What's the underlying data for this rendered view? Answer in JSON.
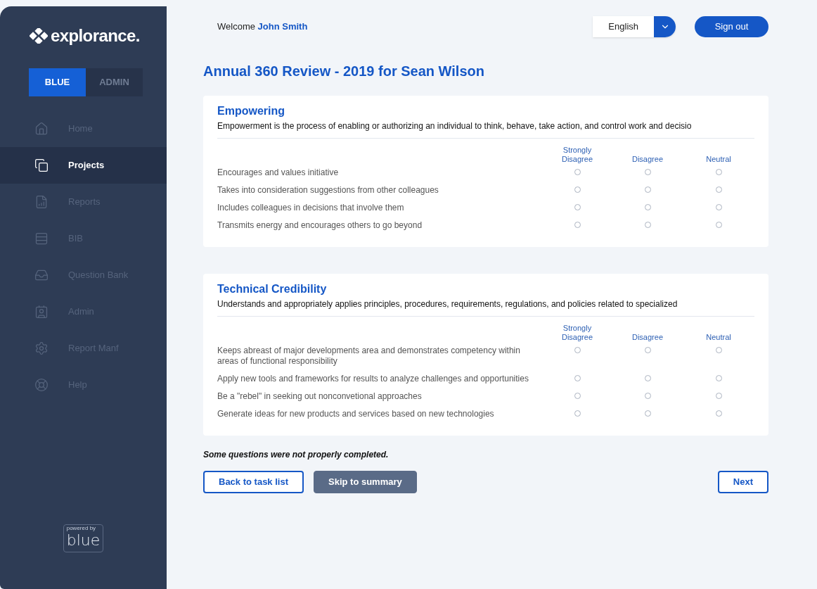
{
  "sidebar": {
    "logo": "explorance.",
    "modes": [
      {
        "label": "BLUE",
        "selected": true
      },
      {
        "label": "ADMIN",
        "selected": false
      }
    ],
    "items": [
      {
        "label": "Home",
        "selected": false
      },
      {
        "label": "Projects",
        "selected": true
      },
      {
        "label": "Reports",
        "selected": false
      },
      {
        "label": "BIB",
        "selected": false
      },
      {
        "label": "Question Bank",
        "selected": false
      },
      {
        "label": "Admin",
        "selected": false
      },
      {
        "label": "Report Manf",
        "selected": false
      },
      {
        "label": "Help",
        "selected": false
      }
    ],
    "badge": {
      "caption": "powered by",
      "name": "blue"
    }
  },
  "header": {
    "welcome": "Welcome",
    "user": "John Smith",
    "language": "English",
    "sign_out": "Sign out"
  },
  "title": "Annual 360 Review - 2019 for Sean Wilson",
  "sections": [
    {
      "title": "Empowering",
      "description": "Empowerment is the process of enabling or authorizing an individual to think, behave, take action, and control work and decisio",
      "columns": [
        "Strongly Disagree",
        "Disagree",
        "Neutral"
      ],
      "questions": [
        {
          "text": "Encourages and values initiative",
          "options": [
            {
              "selected": false
            },
            {
              "selected": false
            },
            {
              "selected": false
            }
          ]
        },
        {
          "text": "Takes into consideration suggestions from other colleagues",
          "options": [
            {
              "selected": false
            },
            {
              "selected": false
            },
            {
              "selected": false
            }
          ]
        },
        {
          "text": "Includes colleagues in decisions that involve them",
          "options": [
            {
              "selected": false
            },
            {
              "selected": false
            },
            {
              "selected": false
            }
          ]
        },
        {
          "text": "Transmits energy and encourages others to go beyond",
          "options": [
            {
              "selected": false
            },
            {
              "selected": false
            },
            {
              "selected": false
            }
          ]
        }
      ]
    },
    {
      "title": "Technical Credibility",
      "description": "Understands and appropriately applies principles, procedures, requirements, regulations, and policies related to specialized",
      "columns": [
        "Strongly Disagree",
        "Disagree",
        "Neutral"
      ],
      "questions": [
        {
          "text": "Keeps abreast of major developments area and demonstrates competency within areas of functional responsibility",
          "options": [
            {
              "selected": false
            },
            {
              "selected": false
            },
            {
              "selected": false
            }
          ]
        },
        {
          "text": "Apply new tools and frameworks for results to analyze challenges and opportunities",
          "options": [
            {
              "selected": false
            },
            {
              "selected": false
            },
            {
              "selected": false
            }
          ]
        },
        {
          "text": "Be a \"rebel\" in seeking out nonconvetional approaches",
          "options": [
            {
              "selected": false
            },
            {
              "selected": false
            },
            {
              "selected": false
            }
          ]
        },
        {
          "text": "Generate ideas for new products and services based on new technologies",
          "options": [
            {
              "selected": false
            },
            {
              "selected": false
            },
            {
              "selected": false
            }
          ]
        }
      ]
    }
  ],
  "warning": "Some questions were not properly completed.",
  "buttons": [
    {
      "label": "Back to task list",
      "kind": "outline"
    },
    {
      "label": "Skip to summary",
      "kind": "filled"
    },
    {
      "label": "Next",
      "kind": "outline"
    }
  ]
}
